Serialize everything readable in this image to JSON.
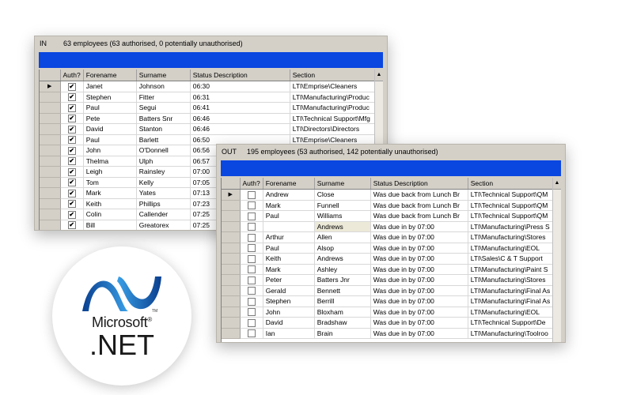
{
  "in_panel": {
    "code": "IN",
    "summary": "63 employees (63 authorised, 0 potentially unauthorised)",
    "columns": [
      "Auth?",
      "Forename",
      "Surname",
      "Status Description",
      "Section"
    ],
    "rows": [
      {
        "auth": true,
        "forename": "Janet",
        "surname": "Johnson",
        "status": "06:30",
        "section": "LTI\\Emprise\\Cleaners"
      },
      {
        "auth": true,
        "forename": "Stephen",
        "surname": "Fitter",
        "status": "06:31",
        "section": "LTI\\Manufacturing\\Produc"
      },
      {
        "auth": true,
        "forename": "Paul",
        "surname": "Segui",
        "status": "06:41",
        "section": "LTI\\Manufacturing\\Produc"
      },
      {
        "auth": true,
        "forename": "Pete",
        "surname": "Batters Snr",
        "status": "06:46",
        "section": "LTI\\Technical Support\\Mfg"
      },
      {
        "auth": true,
        "forename": "David",
        "surname": "Stanton",
        "status": "06:46",
        "section": "LTI\\Directors\\Directors"
      },
      {
        "auth": true,
        "forename": "Paul",
        "surname": "Barlett",
        "status": "06:50",
        "section": "LTI\\Emprise\\Cleaners"
      },
      {
        "auth": true,
        "forename": "John",
        "surname": "O'Donnell",
        "status": "06:56",
        "section": ""
      },
      {
        "auth": true,
        "forename": "Thelma",
        "surname": "Ulph",
        "status": "06:57",
        "section": ""
      },
      {
        "auth": true,
        "forename": "Leigh",
        "surname": "Rainsley",
        "status": "07:00",
        "section": ""
      },
      {
        "auth": true,
        "forename": "Tom",
        "surname": "Kelly",
        "status": "07:05",
        "section": ""
      },
      {
        "auth": true,
        "forename": "Mark",
        "surname": "Yates",
        "status": "07:13",
        "section": ""
      },
      {
        "auth": true,
        "forename": "Keith",
        "surname": "Phillips",
        "status": "07:23",
        "section": ""
      },
      {
        "auth": true,
        "forename": "Colin",
        "surname": "Callender",
        "status": "07:25",
        "section": ""
      },
      {
        "auth": true,
        "forename": "Bill",
        "surname": "Greatorex",
        "status": "07:25",
        "section": ""
      }
    ]
  },
  "out_panel": {
    "code": "OUT",
    "summary": "195 employees (53 authorised, 142 potentially unauthorised)",
    "columns": [
      "Auth?",
      "Forename",
      "Surname",
      "Status Description",
      "Section"
    ],
    "rows": [
      {
        "auth": false,
        "forename": "Andrew",
        "surname": "Close",
        "status": "Was due back from Lunch Br",
        "section": "LTI\\Technical Support\\QM"
      },
      {
        "auth": false,
        "forename": "Mark",
        "surname": "Funnell",
        "status": "Was due back from Lunch Br",
        "section": "LTI\\Technical Support\\QM"
      },
      {
        "auth": false,
        "forename": "Paul",
        "surname": "Williams",
        "status": "Was due back from Lunch Br",
        "section": "LTI\\Technical Support\\QM"
      },
      {
        "auth": false,
        "forename": "",
        "surname": "Andrews",
        "status": "Was due in by 07:00",
        "section": "LTI\\Manufacturing\\Press S"
      },
      {
        "auth": false,
        "forename": "Arthur",
        "surname": "Allen",
        "status": "Was due in by 07:00",
        "section": "LTI\\Manufacturing\\Stores"
      },
      {
        "auth": false,
        "forename": "Paul",
        "surname": "Alsop",
        "status": "Was due in by 07:00",
        "section": "LTI\\Manufacturing\\EOL"
      },
      {
        "auth": false,
        "forename": "Keith",
        "surname": "Andrews",
        "status": "Was due in by 07:00",
        "section": "LTI\\Sales\\C & T Support"
      },
      {
        "auth": false,
        "forename": "Mark",
        "surname": "Ashley",
        "status": "Was due in by 07:00",
        "section": "LTI\\Manufacturing\\Paint S"
      },
      {
        "auth": false,
        "forename": "Peter",
        "surname": "Batters Jnr",
        "status": "Was due in by 07:00",
        "section": "LTI\\Manufacturing\\Stores"
      },
      {
        "auth": false,
        "forename": "Gerald",
        "surname": "Bennett",
        "status": "Was due in by 07:00",
        "section": "LTI\\Manufacturing\\Final As"
      },
      {
        "auth": false,
        "forename": "Stephen",
        "surname": "Berrill",
        "status": "Was due in by 07:00",
        "section": "LTI\\Manufacturing\\Final As"
      },
      {
        "auth": false,
        "forename": "John",
        "surname": "Bloxham",
        "status": "Was due in by 07:00",
        "section": "LTI\\Manufacturing\\EOL"
      },
      {
        "auth": false,
        "forename": "David",
        "surname": "Bradshaw",
        "status": "Was due in by 07:00",
        "section": "LTI\\Technical Support\\De"
      },
      {
        "auth": false,
        "forename": "Ian",
        "surname": "Brain",
        "status": "Was due in by 07:00",
        "section": "LTI\\Manufacturing\\Toolroo"
      }
    ]
  },
  "logo": {
    "brand": "Microsoft",
    "registered": "®",
    "product": ".NET",
    "trademark": "TM",
    "colors": {
      "wave_dark": "#0a3f8f",
      "wave_light": "#3aa0e8",
      "text": "#1a1a1a"
    }
  },
  "icons": {
    "row_pointer": "▶",
    "checked": "✔",
    "scroll_up": "▲"
  }
}
